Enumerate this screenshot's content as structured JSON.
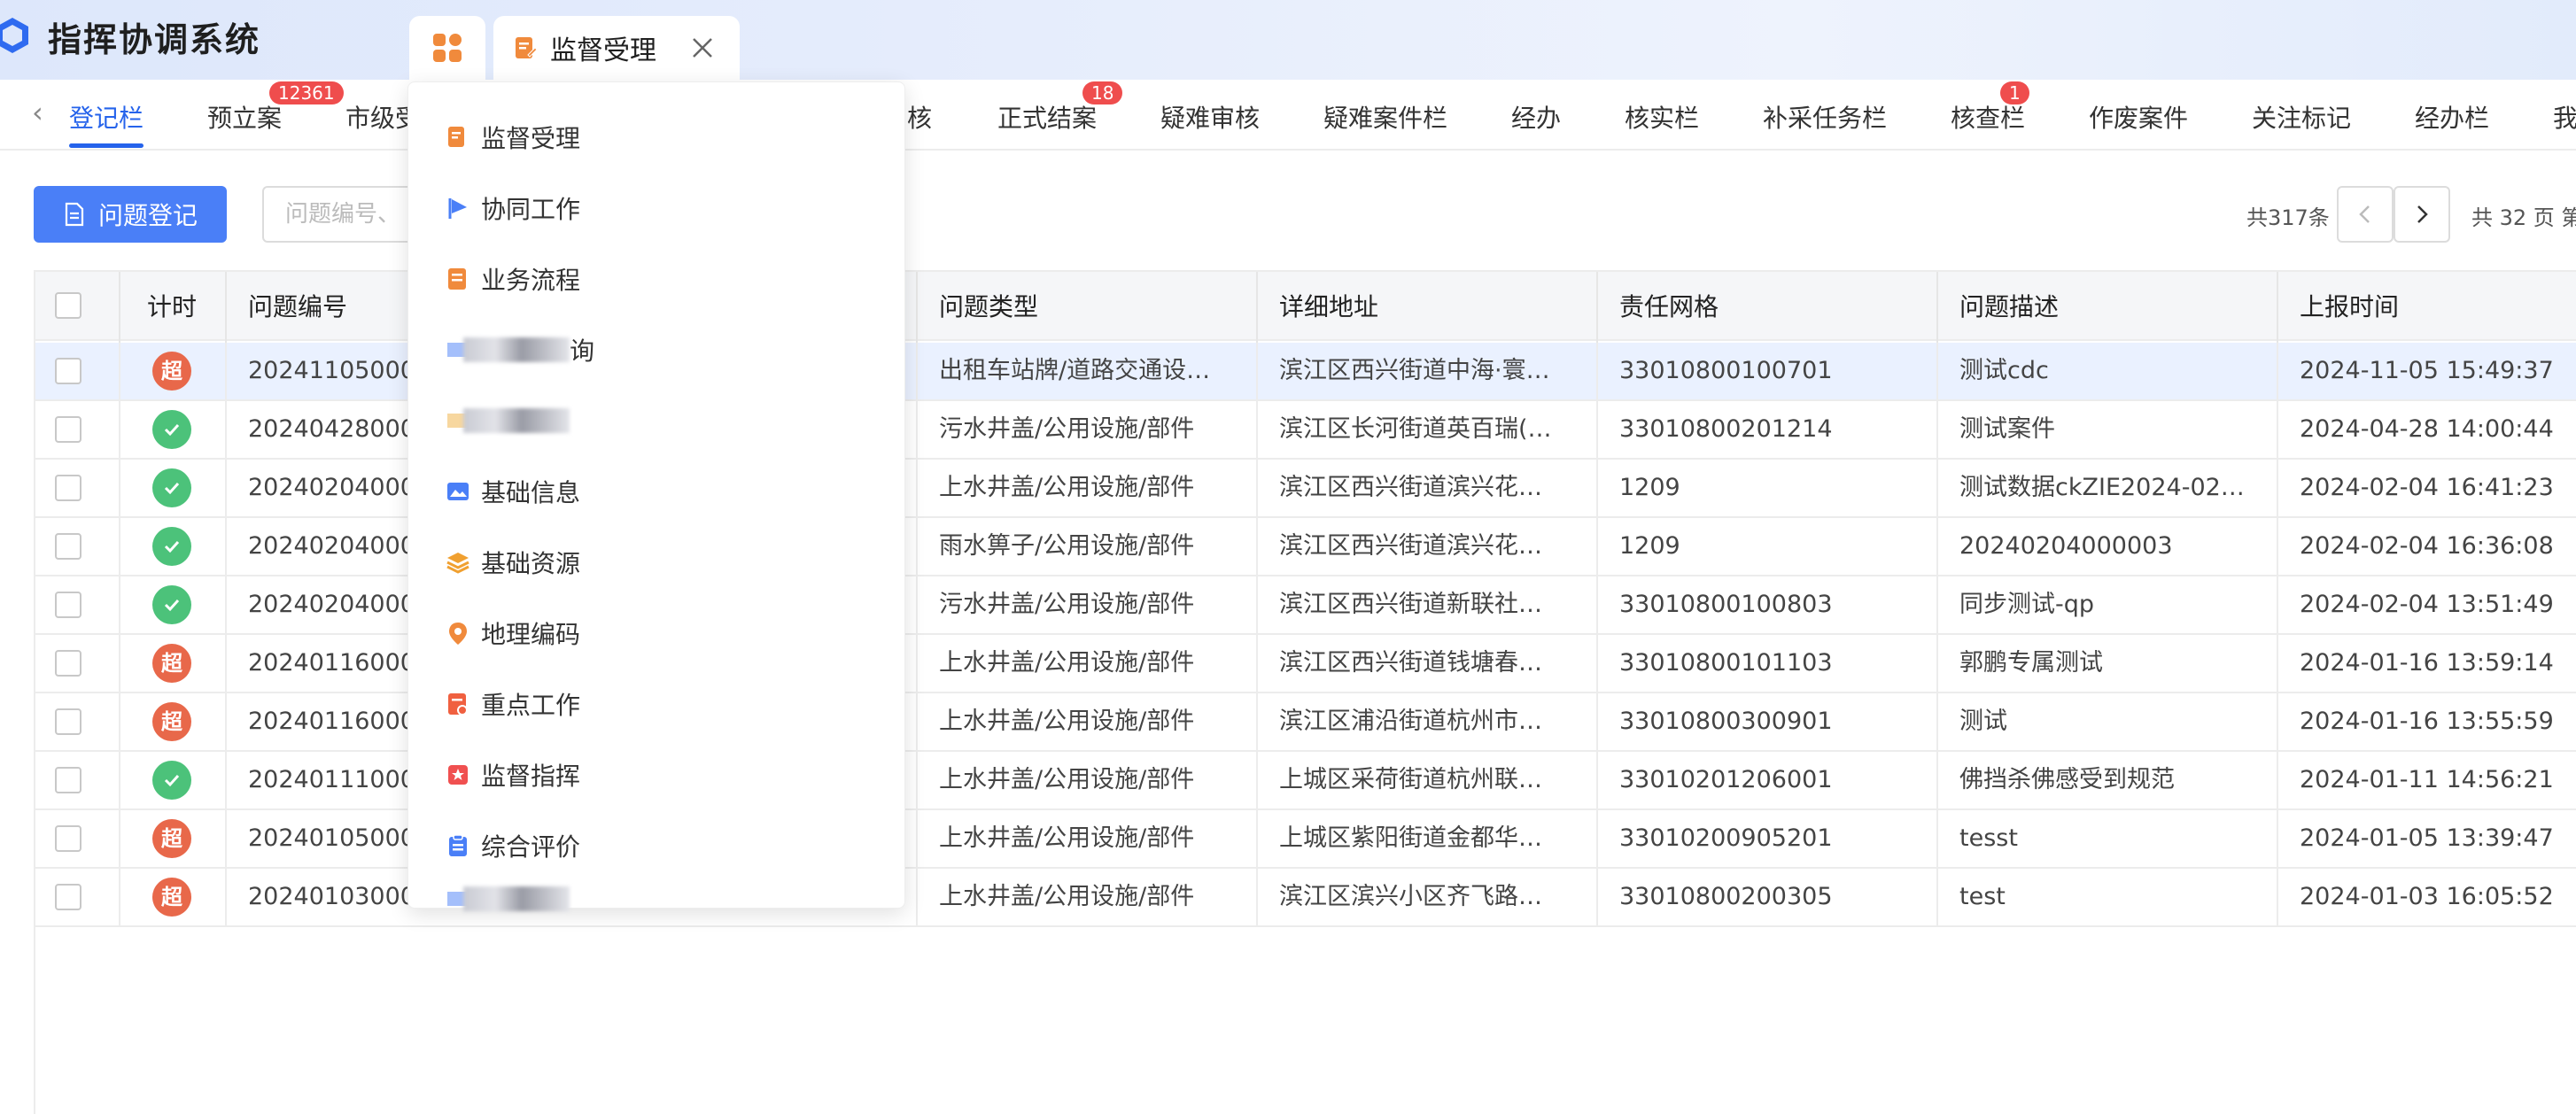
{
  "app": {
    "title": "指挥协调系统"
  },
  "tabs": {
    "open_tab_label": "监督受理"
  },
  "subnav": {
    "items": [
      {
        "label": "登记栏",
        "active": true,
        "badge": ""
      },
      {
        "label": "预立案",
        "badge": "12361"
      },
      {
        "label": "市级受",
        "badge": ""
      },
      {
        "label": "核",
        "badge": ""
      },
      {
        "label": "正式结案",
        "badge": "18"
      },
      {
        "label": "疑难审核",
        "badge": ""
      },
      {
        "label": "疑难案件栏",
        "badge": ""
      },
      {
        "label": "经办",
        "badge": ""
      },
      {
        "label": "核实栏",
        "badge": ""
      },
      {
        "label": "补采任务栏",
        "badge": ""
      },
      {
        "label": "核查栏",
        "badge": "1"
      },
      {
        "label": "作废案件",
        "badge": ""
      },
      {
        "label": "关注标记",
        "badge": ""
      },
      {
        "label": "经办栏",
        "badge": ""
      },
      {
        "label": "我",
        "badge": ""
      }
    ]
  },
  "toolbar": {
    "register_label": "问题登记",
    "search_placeholder": "问题编号、"
  },
  "pager": {
    "total": "共317条",
    "pages": "共 32 页 第"
  },
  "table": {
    "headers": [
      "计时",
      "问题编号",
      "问题类型",
      "详细地址",
      "责任网格",
      "问题描述",
      "上报时间"
    ],
    "rows": [
      {
        "status": "over",
        "status_text": "超",
        "id": "202411050000",
        "type": "出租车站牌/道路交通设…",
        "address": "滨江区西兴街道中海·寰…",
        "grid": "33010800100701",
        "desc": "测试cdc",
        "time": "2024-11-05 15:49:37"
      },
      {
        "status": "ok",
        "status_text": "",
        "id": "202404280000",
        "type": "污水井盖/公用设施/部件",
        "address": "滨江区长河街道英百瑞(…",
        "grid": "33010800201214",
        "desc": "测试案件",
        "time": "2024-04-28 14:00:44"
      },
      {
        "status": "ok",
        "status_text": "",
        "id": "202402040000",
        "type": "上水井盖/公用设施/部件",
        "address": "滨江区西兴街道滨兴花…",
        "grid": "1209",
        "desc": "测试数据ckZIE2024-02…",
        "time": "2024-02-04 16:41:23"
      },
      {
        "status": "ok",
        "status_text": "",
        "id": "202402040000",
        "type": "雨水箅子/公用设施/部件",
        "address": "滨江区西兴街道滨兴花…",
        "grid": "1209",
        "desc": "20240204000003",
        "time": "2024-02-04 16:36:08"
      },
      {
        "status": "ok",
        "status_text": "",
        "id": "202402040000",
        "type": "污水井盖/公用设施/部件",
        "address": "滨江区西兴街道新联社…",
        "grid": "33010800100803",
        "desc": "同步测试-qp",
        "time": "2024-02-04 13:51:49"
      },
      {
        "status": "over",
        "status_text": "超",
        "id": "202401160000",
        "type": "上水井盖/公用设施/部件",
        "address": "滨江区西兴街道钱塘春…",
        "grid": "33010800101103",
        "desc": "郭鹏专属测试",
        "time": "2024-01-16 13:59:14"
      },
      {
        "status": "over",
        "status_text": "超",
        "id": "202401160000",
        "type": "上水井盖/公用设施/部件",
        "address": "滨江区浦沿街道杭州市…",
        "grid": "33010800300901",
        "desc": "测试",
        "time": "2024-01-16 13:55:59"
      },
      {
        "status": "ok",
        "status_text": "",
        "id": "202401110000",
        "type": "上水井盖/公用设施/部件",
        "address": "上城区采荷街道杭州联…",
        "grid": "33010201206001",
        "desc": "佛挡杀佛感受到规范",
        "time": "2024-01-11 14:56:21"
      },
      {
        "status": "over",
        "status_text": "超",
        "id": "202401050000",
        "type": "上水井盖/公用设施/部件",
        "address": "上城区紫阳街道金都华…",
        "grid": "33010200905201",
        "desc": "tesst",
        "time": "2024-01-05 13:39:47"
      },
      {
        "status": "over",
        "status_text": "超",
        "id": "202401030000",
        "type": "上水井盖/公用设施/部件",
        "address": "滨江区滨兴小区齐飞路…",
        "grid": "33010800200305",
        "desc": "test",
        "time": "2024-01-03 16:05:52"
      }
    ]
  },
  "dropdown": {
    "items": [
      {
        "label": "监督受理",
        "icon": "edit-doc-icon",
        "color": "#f08a3c"
      },
      {
        "label": "协同工作",
        "icon": "flag-icon",
        "color": "#4a7ff7"
      },
      {
        "label": "业务流程",
        "icon": "process-doc-icon",
        "color": "#f08a3c"
      },
      {
        "label": "询",
        "icon": "blurred-icon",
        "color": "#4a7ff7"
      },
      {
        "label": "",
        "icon": "blurred-icon",
        "color": "#f0b040"
      },
      {
        "label": "基础信息",
        "icon": "picture-icon",
        "color": "#4a7ff7"
      },
      {
        "label": "基础资源",
        "icon": "layers-icon",
        "color": "#f0a030"
      },
      {
        "label": "地理编码",
        "icon": "location-pin-icon",
        "color": "#f08a3c"
      },
      {
        "label": "重点工作",
        "icon": "task-doc-icon",
        "color": "#f06040"
      },
      {
        "label": "监督指挥",
        "icon": "star-badge-icon",
        "color": "#f05050"
      },
      {
        "label": "综合评价",
        "icon": "clipboard-icon",
        "color": "#4a7ff7"
      },
      {
        "label": "",
        "icon": "blurred-icon",
        "color": "#4a7ff7"
      }
    ]
  },
  "colors": {
    "accent": "#4a7ff7",
    "overdue": "#e8684a",
    "ok": "#4cc27a",
    "badge": "#ef4d4d"
  }
}
